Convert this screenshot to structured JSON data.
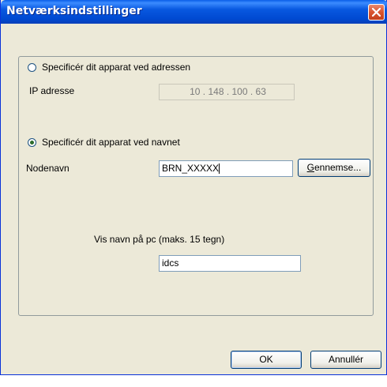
{
  "window": {
    "title": "Netværksindstillinger"
  },
  "options": {
    "by_address_label": "Specificér dit apparat ved adressen",
    "ip_label": "IP adresse",
    "ip_value": "10 . 148 . 100 . 63",
    "by_name_label": "Specificér dit apparat ved navnet",
    "node_label": "Nodenavn",
    "node_value": "BRN_XXXXX",
    "browse_label": "Gennemse...",
    "pc_name_label": "Vis navn på pc (maks. 15 tegn)",
    "pc_name_value": "idcs",
    "selected": "by_name"
  },
  "buttons": {
    "ok": "OK",
    "cancel": "Annullér"
  }
}
